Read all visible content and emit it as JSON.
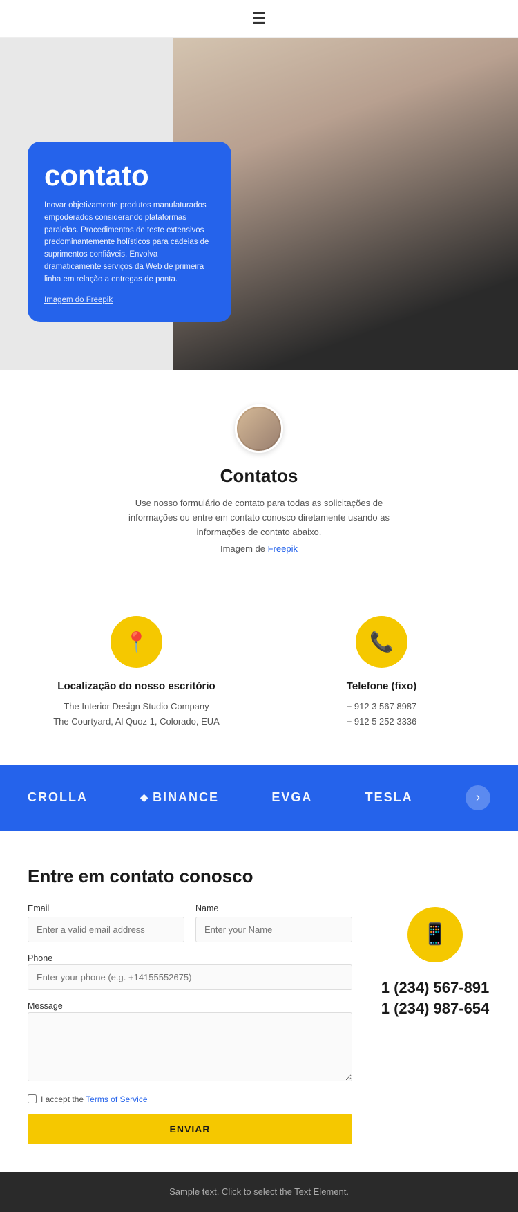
{
  "nav": {
    "hamburger_icon": "☰"
  },
  "hero": {
    "title": "contato",
    "description": "Inovar objetivamente produtos manufaturados empoderados considerando plataformas paralelas. Procedimentos de teste extensivos predominantemente holísticos para cadeias de suprimentos confiáveis. Envolva dramaticamente serviços da Web de primeira linha em relação a entregas de ponta.",
    "image_credit": "Imagem do Freepik"
  },
  "contacts_section": {
    "title": "Contatos",
    "description": "Use nosso formulário de contato para todas as solicitações de informações ou entre em contato conosco diretamente usando as informações de contato abaixo.",
    "image_credit_prefix": "Imagem de ",
    "image_credit_link": "Freepik"
  },
  "contact_cards": [
    {
      "icon": "📍",
      "title": "Localização do nosso escritório",
      "line1": "The Interior Design Studio Company",
      "line2": "The Courtyard, Al Quoz 1, Colorado, EUA"
    },
    {
      "icon": "📞",
      "title": "Telefone (fixo)",
      "line1": "+ 912 3 567 8987",
      "line2": "+ 912 5 252 3336"
    }
  ],
  "brands": {
    "logos": [
      "CROLLA",
      "◆BINANCE",
      "EVGA",
      "TESLA"
    ],
    "nav_icon": "›"
  },
  "form_section": {
    "title": "Entre em contato conosco",
    "email_label": "Email",
    "email_placeholder": "Enter a valid email address",
    "name_label": "Name",
    "name_placeholder": "Enter your Name",
    "phone_label": "Phone",
    "phone_placeholder": "Enter your phone (e.g. +14155552675)",
    "message_label": "Message",
    "terms_text": "I accept the ",
    "terms_link": "Terms of Service",
    "submit_label": "ENVIAR",
    "phone_number1": "1 (234) 567-891",
    "phone_number2": "1 (234) 987-654"
  },
  "footer": {
    "text": "Sample text. Click to select the Text Element."
  }
}
